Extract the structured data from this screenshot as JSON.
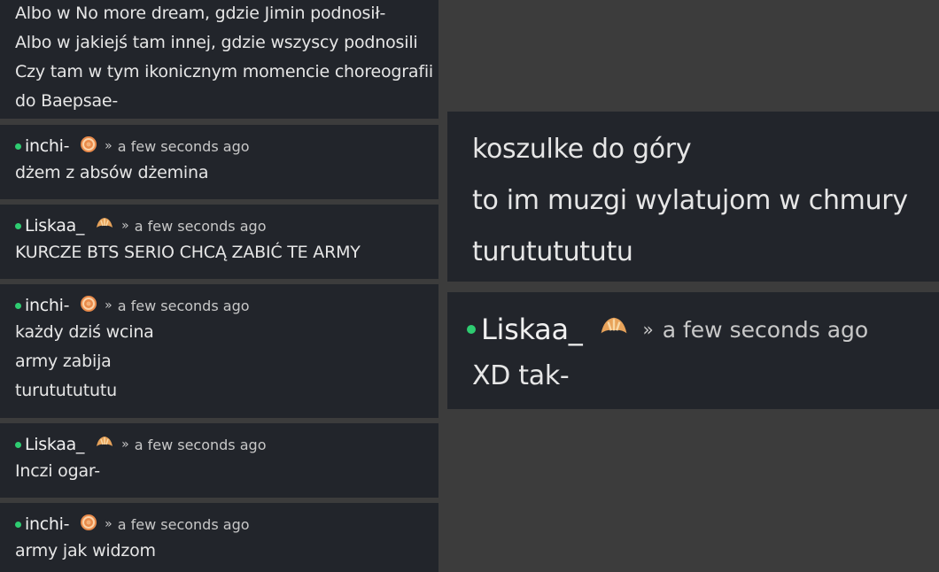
{
  "top_block": {
    "lines": [
      "Albo w No more dream, gdzie Jimin podnosił-",
      "Albo w jakiejś tam innej, gdzie wszyscy podnosili",
      "Czy tam w tym ikonicznym momencie choreografii",
      "do Baepsae-"
    ]
  },
  "messages": [
    {
      "user": "inchi-",
      "separator": "»",
      "time": "a few seconds ago",
      "lines": [
        "dżem z absów dżemina"
      ]
    },
    {
      "user": "Liskaa_",
      "separator": "»",
      "time": "a few seconds ago",
      "lines": [
        "KURCZE BTS SERIO CHCĄ ZABIĆ TE ARMY"
      ]
    },
    {
      "user": "inchi-",
      "separator": "»",
      "time": "a few seconds ago",
      "lines": [
        "każdy dziś wcina",
        "army zabija",
        "turututututu"
      ]
    },
    {
      "user": "Liskaa_",
      "separator": "»",
      "time": "a few seconds ago",
      "lines": [
        "Inczi ogar-"
      ]
    },
    {
      "user": "inchi-",
      "separator": "»",
      "time": "a few seconds ago",
      "lines": [
        "army jak widzom"
      ]
    }
  ],
  "zoom": {
    "card1": {
      "lines": [
        "koszulke do góry",
        "to im muzgi wylatujom w chmury",
        "turututututu"
      ]
    },
    "card2": {
      "user": "Liskaa_",
      "separator": "»",
      "time": "a few seconds ago",
      "lines": [
        "XD tak-"
      ]
    }
  },
  "colors": {
    "online_dot": "#2ecc71",
    "card_bg": "#22252b",
    "page_bg": "#3c3c3c"
  },
  "icons": {
    "inchi_avatar": "orange-swirl-avatar-icon",
    "liskaa_avatar": "croissant-avatar-icon"
  }
}
